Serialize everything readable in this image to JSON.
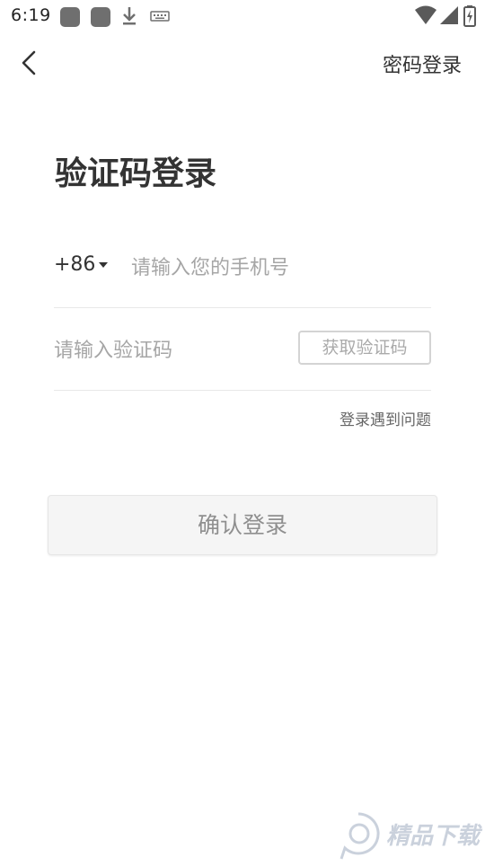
{
  "status_bar": {
    "time": "6:19",
    "icons": [
      "notification-square-icon",
      "notification-square-icon",
      "download-icon",
      "keyboard-icon",
      "wifi-icon",
      "signal-icon",
      "battery-icon"
    ]
  },
  "header": {
    "back_icon": "chevron-left-icon",
    "password_login_label": "密码登录"
  },
  "page": {
    "title": "验证码登录"
  },
  "form": {
    "country_code": "+86",
    "phone_placeholder": "请输入您的手机号",
    "phone_value": "",
    "code_placeholder": "请输入验证码",
    "code_value": "",
    "get_code_label": "获取验证码",
    "help_link": "登录遇到问题",
    "confirm_label": "确认登录"
  },
  "watermark": {
    "text": "精品下载"
  },
  "colors": {
    "primary_text": "#333333",
    "placeholder": "#a6a6a6",
    "divider": "#e8e8e8",
    "disabled_button_bg": "#f5f5f5",
    "disabled_button_text": "#8f8f8f"
  }
}
